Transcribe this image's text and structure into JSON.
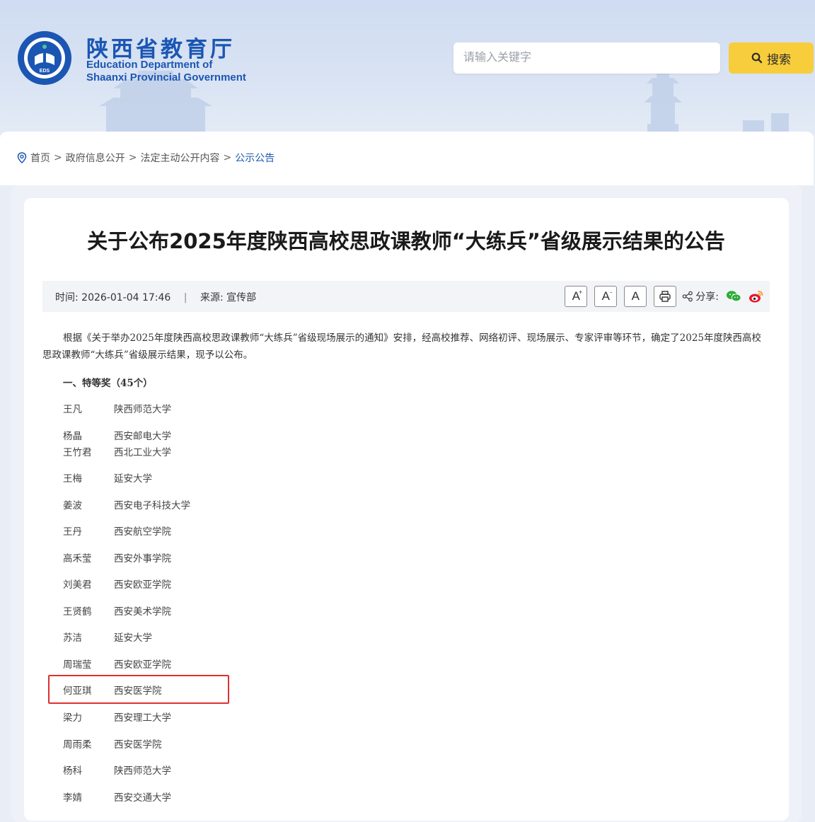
{
  "header": {
    "logo_text": "EDUCATION DEPARTMENT OF SHAANXI EDS",
    "brand_cn": "陕西省教育厅",
    "brand_en_line1": "Education Department of",
    "brand_en_line2": "Shaanxi Provincial Government",
    "search_placeholder": "请输入关键字",
    "search_button": "搜索"
  },
  "breadcrumb": {
    "items": [
      "首页",
      "政府信息公开",
      "法定主动公开内容",
      "公示公告"
    ],
    "separator": ">"
  },
  "article": {
    "title": "关于公布2025年度陕西高校思政课教师“大练兵”省级展示结果的公告",
    "time_label": "时间:",
    "time_value": "2026-01-04 17:46",
    "source_label": "来源:",
    "source_value": "宣传部",
    "share_label": "分享:",
    "font_tools": [
      "A",
      "A",
      "A"
    ],
    "intro": "根据《关于举办2025年度陕西高校思政课教师“大练兵”省级现场展示的通知》安排，经高校推荐、网络初评、现场展示、专家评审等环节，确定了2025年度陕西高校思政课教师“大练兵”省级展示结果，现予以公布。",
    "section_title": "一、特等奖（45个）",
    "winners": [
      {
        "name": "王凡",
        "school": "陕西师范大学"
      },
      {
        "name": "杨晶",
        "school": "西安邮电大学"
      },
      {
        "name": "王竹君",
        "school": "西北工业大学"
      },
      {
        "name": "王梅",
        "school": "延安大学"
      },
      {
        "name": "姜波",
        "school": "西安电子科技大学"
      },
      {
        "name": "王丹",
        "school": "西安航空学院"
      },
      {
        "name": "高禾莹",
        "school": "西安外事学院"
      },
      {
        "name": "刘美君",
        "school": "西安欧亚学院"
      },
      {
        "name": "王贤鹤",
        "school": "西安美术学院"
      },
      {
        "name": "苏洁",
        "school": "延安大学"
      },
      {
        "name": "周瑞莹",
        "school": "西安欧亚学院"
      },
      {
        "name": "何亚琪",
        "school": "西安医学院"
      },
      {
        "name": "梁力",
        "school": "西安理工大学"
      },
      {
        "name": "周雨柔",
        "school": "西安医学院"
      },
      {
        "name": "杨科",
        "school": "陕西师范大学"
      },
      {
        "name": "李婧",
        "school": "西安交通大学"
      }
    ],
    "highlighted_winner": "何亚琪"
  },
  "colors": {
    "brand_blue": "#1b56b3",
    "search_yellow": "#f7cd3c",
    "highlight_red": "#e03030"
  },
  "icons": [
    "location-pin-icon",
    "search-icon",
    "print-icon",
    "share-icon",
    "wechat-icon",
    "weibo-icon"
  ]
}
